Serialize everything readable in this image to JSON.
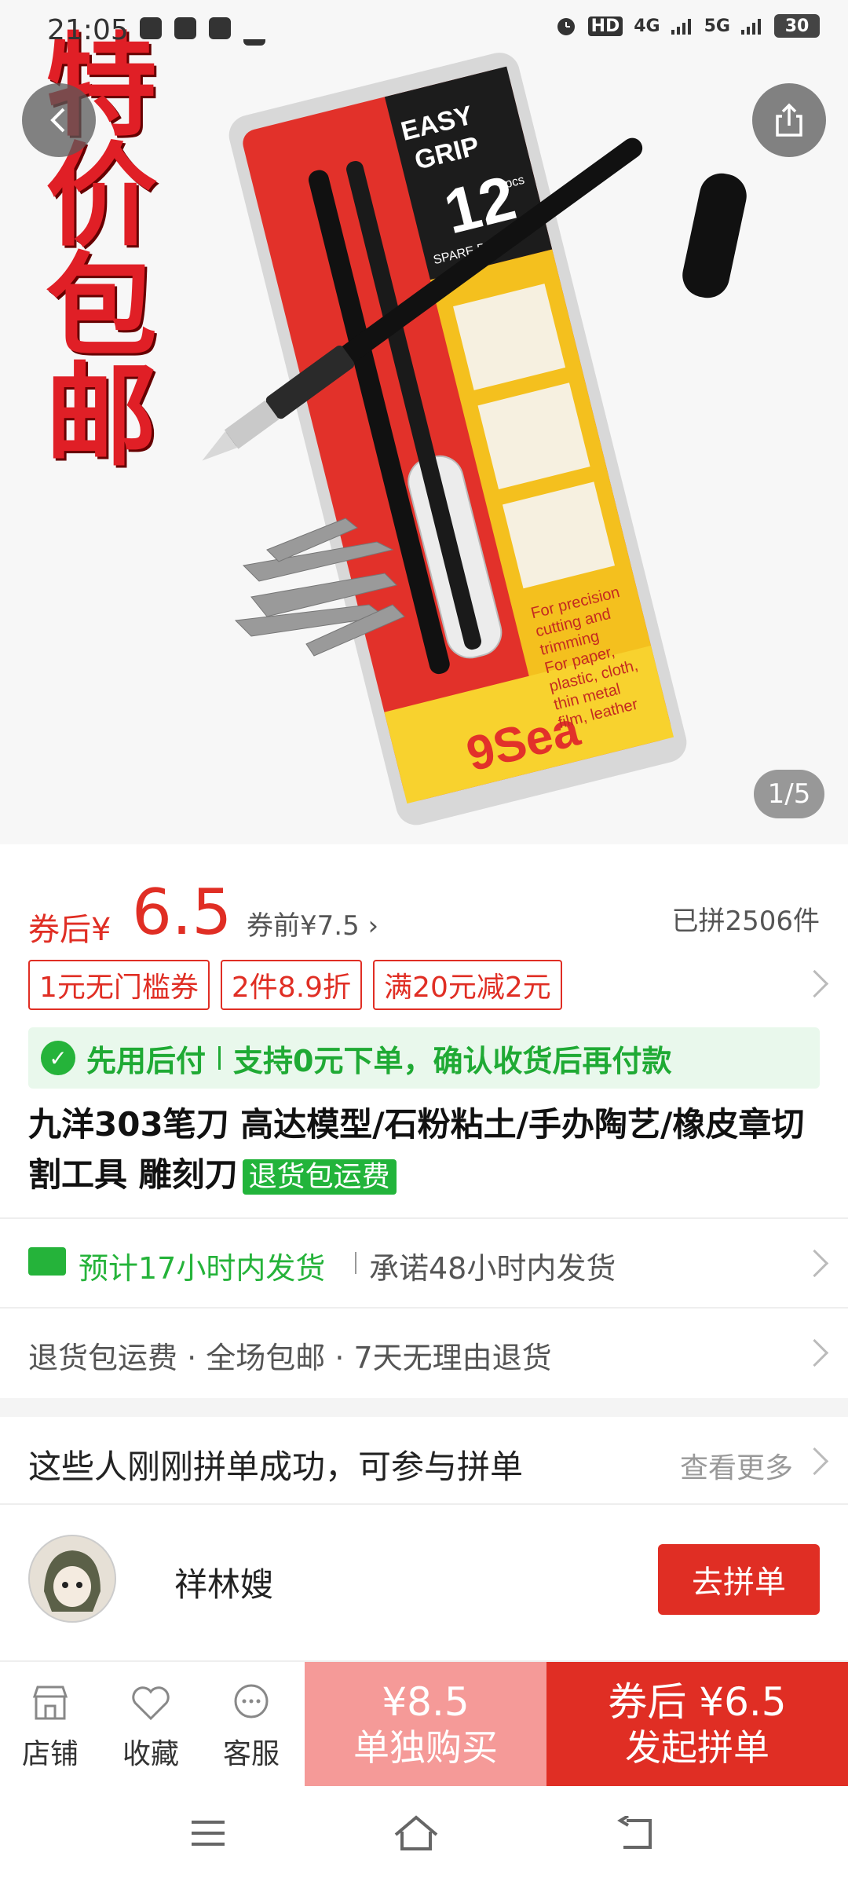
{
  "status_bar": {
    "time": "21:05",
    "hd": "HD",
    "net1": "4G",
    "net2": "5G",
    "battery": "30"
  },
  "hero": {
    "promo_text": "特价包邮",
    "page_indicator": "1/5",
    "package_text": {
      "line1": "EASY",
      "line2": "GRIP",
      "count": "12",
      "pcs": "pcs",
      "spare": "SPARE BLADE",
      "brand": "9Sea",
      "desc": [
        "For precision",
        "cutting and",
        "trimming",
        "For paper,",
        "plastic, cloth,",
        "thin metal",
        "film, leather"
      ]
    }
  },
  "price": {
    "after_label": "券后¥",
    "after_value": "6.5",
    "before_text": "券前¥7.5",
    "sold": "已拼2506件"
  },
  "coupons": [
    "1元无门槛券",
    "2件8.9折",
    "满20元减2元"
  ],
  "pay_later": {
    "title": "先用后付",
    "desc": "支持0元下单，确认收货后再付款"
  },
  "product": {
    "title": "九洋303笔刀 高达模型/石粉粘土/手办陶艺/橡皮章切割工具 雕刻刀",
    "badge": "退货包运费"
  },
  "shipping": {
    "estimate": "预计17小时内发货",
    "promise": "承诺48小时内发货"
  },
  "services": "退货包运费 · 全场包邮 · 7天无理由退货",
  "group": {
    "heading": "这些人刚刚拼单成功，可参与拼单",
    "more": "查看更多",
    "member_name": "祥林嫂",
    "join_label": "去拼单"
  },
  "bottom_bar": {
    "tabs": [
      {
        "label": "店铺",
        "icon": "store-icon"
      },
      {
        "label": "收藏",
        "icon": "heart-icon"
      },
      {
        "label": "客服",
        "icon": "chat-icon"
      }
    ],
    "solo": {
      "price": "¥8.5",
      "label": "单独购买"
    },
    "group_buy": {
      "price": "券后 ¥6.5",
      "label": "发起拼单"
    }
  },
  "colors": {
    "accent": "#e02e24",
    "green": "#25b33a"
  }
}
